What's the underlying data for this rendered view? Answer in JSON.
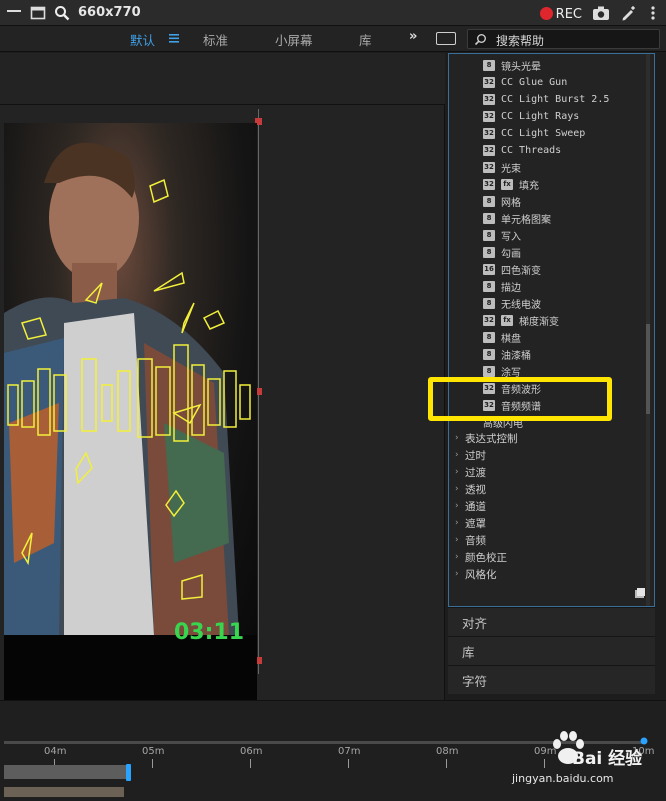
{
  "recorder": {
    "size_label": "660x770",
    "rec_label": "REC"
  },
  "workspace": {
    "tabs": [
      "默认",
      "标准",
      "小屏幕",
      "库"
    ],
    "more": "»",
    "search_placeholder": "搜索帮助"
  },
  "viewer": {
    "timecode": "03:11"
  },
  "effects": {
    "items": [
      {
        "badge": "8",
        "label": "镜头光晕"
      },
      {
        "badge": "32",
        "label": "CC Glue Gun",
        "mono": true
      },
      {
        "badge": "32",
        "label": "CC Light Burst 2.5",
        "mono": true
      },
      {
        "badge": "32",
        "label": "CC Light Rays",
        "mono": true
      },
      {
        "badge": "32",
        "label": "CC Light Sweep",
        "mono": true
      },
      {
        "badge": "32",
        "label": "CC Threads",
        "mono": true
      },
      {
        "badge": "32",
        "label": "光束"
      },
      {
        "badge": "32",
        "badge2": "fx",
        "label": "填充"
      },
      {
        "badge": "8",
        "label": "网格"
      },
      {
        "badge": "8",
        "label": "单元格图案"
      },
      {
        "badge": "8",
        "label": "写入"
      },
      {
        "badge": "8",
        "label": "勾画"
      },
      {
        "badge": "16",
        "label": "四色渐变"
      },
      {
        "badge": "8",
        "label": "描边"
      },
      {
        "badge": "8",
        "label": "无线电波"
      },
      {
        "badge": "32",
        "badge2": "fx",
        "label": "梯度渐变"
      },
      {
        "badge": "8",
        "label": "棋盘"
      },
      {
        "badge": "8",
        "label": "油漆桶"
      },
      {
        "badge": "8",
        "label": "涂写"
      },
      {
        "badge": "32",
        "label": "音频波形"
      },
      {
        "badge": "32",
        "label": "音频频谱"
      },
      {
        "badge": "",
        "label": "高级闪电"
      }
    ],
    "categories": [
      "表达式控制",
      "过时",
      "过渡",
      "透视",
      "通道",
      "遮罩",
      "音频",
      "颜色校正",
      "风格化"
    ]
  },
  "panels": [
    "对齐",
    "库",
    "字符"
  ],
  "timeline": {
    "markers": [
      "04m",
      "05m",
      "06m",
      "07m",
      "08m",
      "09m",
      "10m"
    ]
  },
  "watermark": {
    "brand": "Bai 经验",
    "url": "jingyan.baidu.com"
  },
  "colors": {
    "accent": "#3fa1e8",
    "highlight": "#ffe500",
    "timecode": "#38d64f",
    "rec": "#e0262d"
  }
}
